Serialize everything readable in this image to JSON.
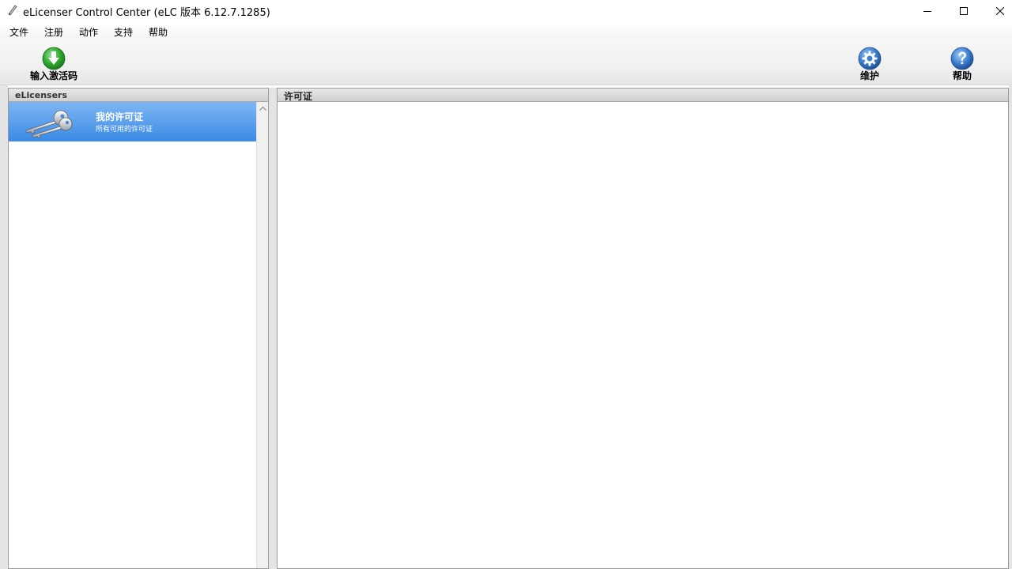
{
  "window": {
    "title": "eLicenser Control Center (eLC 版本 6.12.7.1285)"
  },
  "menu": {
    "items": [
      "文件",
      "注册",
      "动作",
      "支持",
      "帮助"
    ]
  },
  "toolbar": {
    "enter_code_label": "输入激活码",
    "maintenance_label": "维护",
    "help_label": "帮助"
  },
  "left_panel": {
    "header": "eLicensers",
    "items": [
      {
        "title": "我的许可证",
        "subtitle": "所有可用的许可证"
      }
    ]
  },
  "right_panel": {
    "header": "许可证"
  },
  "colors": {
    "selection": "#3a8ae6",
    "download_icon": "#2ea82e",
    "maintenance_icon": "#3d7fd1",
    "help_icon": "#3d7fd1"
  }
}
